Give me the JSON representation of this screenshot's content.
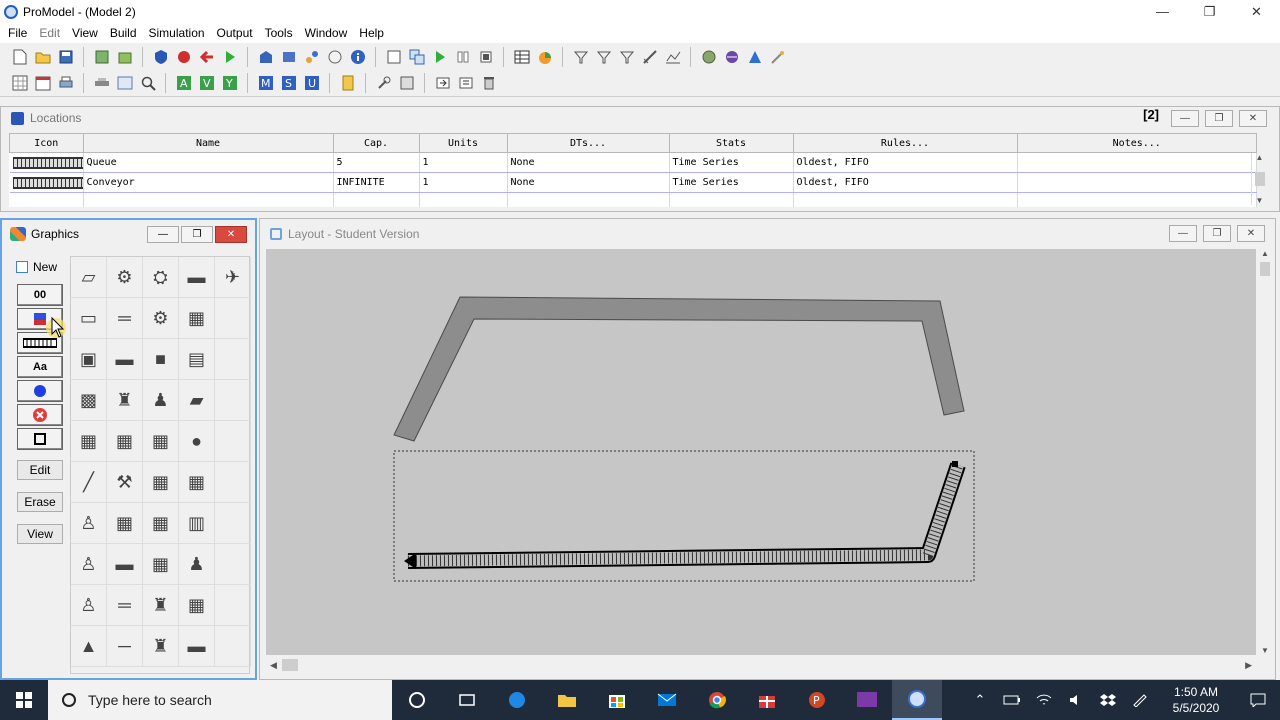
{
  "window": {
    "title": "ProModel - (Model 2)",
    "minimize": "—",
    "restore": "❐",
    "close": "✕"
  },
  "menu": [
    "File",
    "Edit",
    "View",
    "Build",
    "Simulation",
    "Output",
    "Tools",
    "Window",
    "Help"
  ],
  "locations": {
    "title": "Locations",
    "count_label": "[2]",
    "columns": [
      "Icon",
      "Name",
      "Cap.",
      "Units",
      "DTs...",
      "Stats",
      "Rules...",
      "Notes..."
    ],
    "rows": [
      {
        "name": "Queue",
        "cap": "5",
        "units": "1",
        "dts": "None",
        "stats": "Time Series",
        "rules": "Oldest, FIFO",
        "notes": ""
      },
      {
        "name": "Conveyor",
        "cap": "INFINITE",
        "units": "1",
        "dts": "None",
        "stats": "Time Series",
        "rules": "Oldest, FIFO",
        "notes": ""
      }
    ]
  },
  "graphics": {
    "title": "Graphics",
    "new_label": "New",
    "tool_buttons": [
      "00",
      "",
      "",
      "Aa",
      "",
      "",
      ""
    ],
    "edit_label": "Edit",
    "erase_label": "Erase",
    "view_label": "View"
  },
  "layout": {
    "title": "Layout - Student Version"
  },
  "taskbar": {
    "search_placeholder": "Type here to search",
    "time": "1:50 AM",
    "date": "5/5/2020"
  }
}
